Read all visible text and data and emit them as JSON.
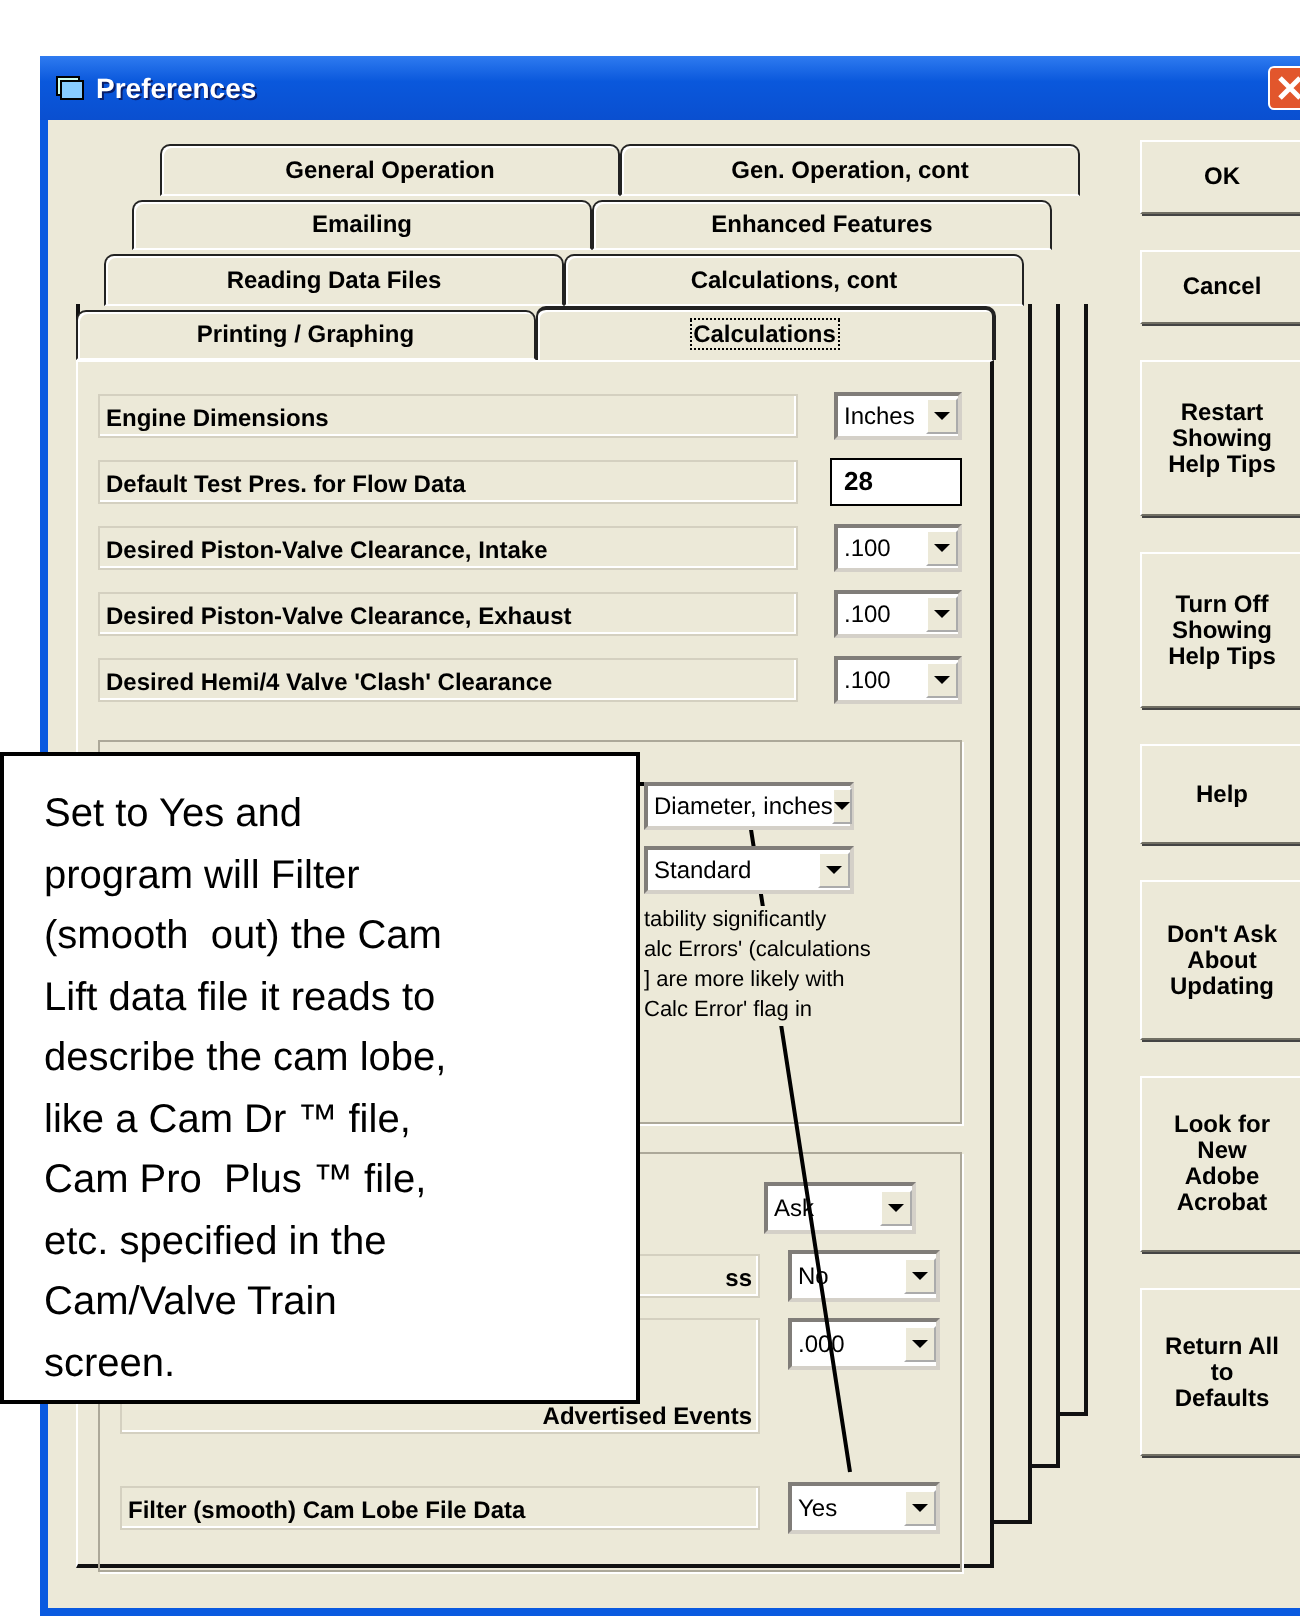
{
  "window": {
    "title": "Preferences"
  },
  "tab_rows": [
    [
      {
        "label": "General Operation",
        "selected": false
      },
      {
        "label": "Gen. Operation, cont",
        "selected": false
      }
    ],
    [
      {
        "label": "Emailing",
        "selected": false
      },
      {
        "label": "Enhanced Features",
        "selected": false
      }
    ],
    [
      {
        "label": "Reading Data Files",
        "selected": false
      },
      {
        "label": "Calculations, cont",
        "selected": false
      }
    ],
    [
      {
        "label": "Printing / Graphing",
        "selected": false
      },
      {
        "label": "Calculations",
        "selected": true
      }
    ]
  ],
  "settings": [
    {
      "kind": "dropdown",
      "label": "Engine Dimensions",
      "value": "Inches"
    },
    {
      "kind": "input",
      "label": "Default Test Pres. for Flow Data",
      "value": "28"
    },
    {
      "kind": "dropdown",
      "label": "Desired Piston-Valve Clearance, Intake",
      "value": ".100"
    },
    {
      "kind": "dropdown",
      "label": "Desired Piston-Valve Clearance, Exhaust",
      "value": ".100"
    },
    {
      "kind": "dropdown",
      "label": "Desired Hemi/4 Valve 'Clash' Clearance",
      "value": ".100"
    }
  ],
  "miscellaneous": {
    "dropdowns": [
      "Diameter, inches",
      "Standard"
    ],
    "note_lines": [
      "tability significantly",
      "alc Errors' (calculations",
      "] are more likely with",
      "Calc Error' flag in"
    ]
  },
  "lower_group": {
    "rows": [
      {
        "value": "Ask"
      },
      {
        "label": "ss",
        "value": "No"
      },
      {
        "label": "Advertised Events",
        "value": ".000"
      },
      {
        "label": "Filter (smooth) Cam Lobe File Data",
        "value": "Yes"
      }
    ]
  },
  "buttons": [
    "OK",
    "Cancel",
    "Restart\nShowing\nHelp Tips",
    "Turn Off\nShowing\nHelp Tips",
    "Help",
    "Don't Ask\nAbout\nUpdating",
    "Look for\nNew\nAdobe\nAcrobat",
    "Return All\nto\nDefaults"
  ],
  "callout": {
    "lines": [
      "Set to Yes and",
      "program will Filter",
      "(smooth  out) the Cam",
      "Lift data file it reads to",
      "describe the cam lobe,",
      "like a Cam Dr ™ file,",
      "Cam Pro  Plus ™ file,",
      "etc. specified in the",
      "Cam/Valve Train",
      "screen."
    ]
  }
}
